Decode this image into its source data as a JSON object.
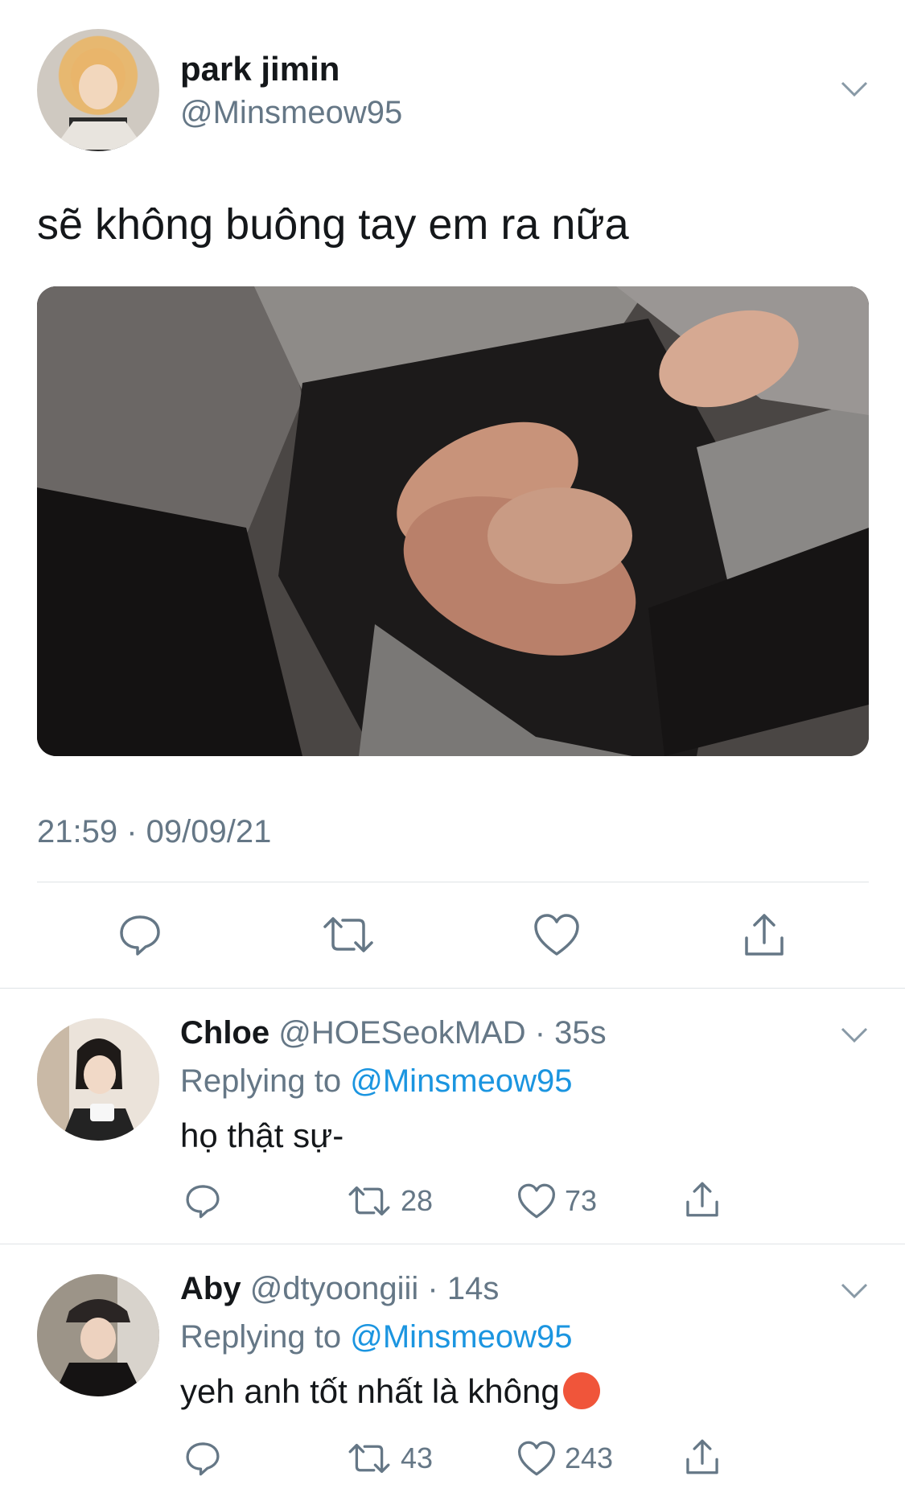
{
  "main_tweet": {
    "display_name": "park jimin",
    "handle": "@Minsmeow95",
    "text": "sẽ không buông tay em ra nữa",
    "timestamp": "21:59 · 09/09/21",
    "icons": {
      "reply": "reply-icon",
      "retweet": "retweet-icon",
      "like": "heart-icon",
      "share": "share-icon",
      "menu": "chevron-down-icon"
    }
  },
  "replies": [
    {
      "display_name": "Chloe",
      "handle": "@HOESeokMAD",
      "time": "35s",
      "replying_label": "Replying to",
      "replying_handle": "@Minsmeow95",
      "text": "họ thật sự-",
      "retweets": "28",
      "likes": "73"
    },
    {
      "display_name": "Aby",
      "handle": "@dtyoongiii",
      "time": "14s",
      "replying_label": "Replying to",
      "replying_handle": "@Minsmeow95",
      "text": "yeh anh tốt nhất là không",
      "emoji": "😡",
      "retweets": "43",
      "likes": "243"
    }
  ],
  "colors": {
    "text_primary": "#14171a",
    "text_secondary": "#657786",
    "link": "#1b95e0",
    "divider": "#dfe3e6"
  }
}
